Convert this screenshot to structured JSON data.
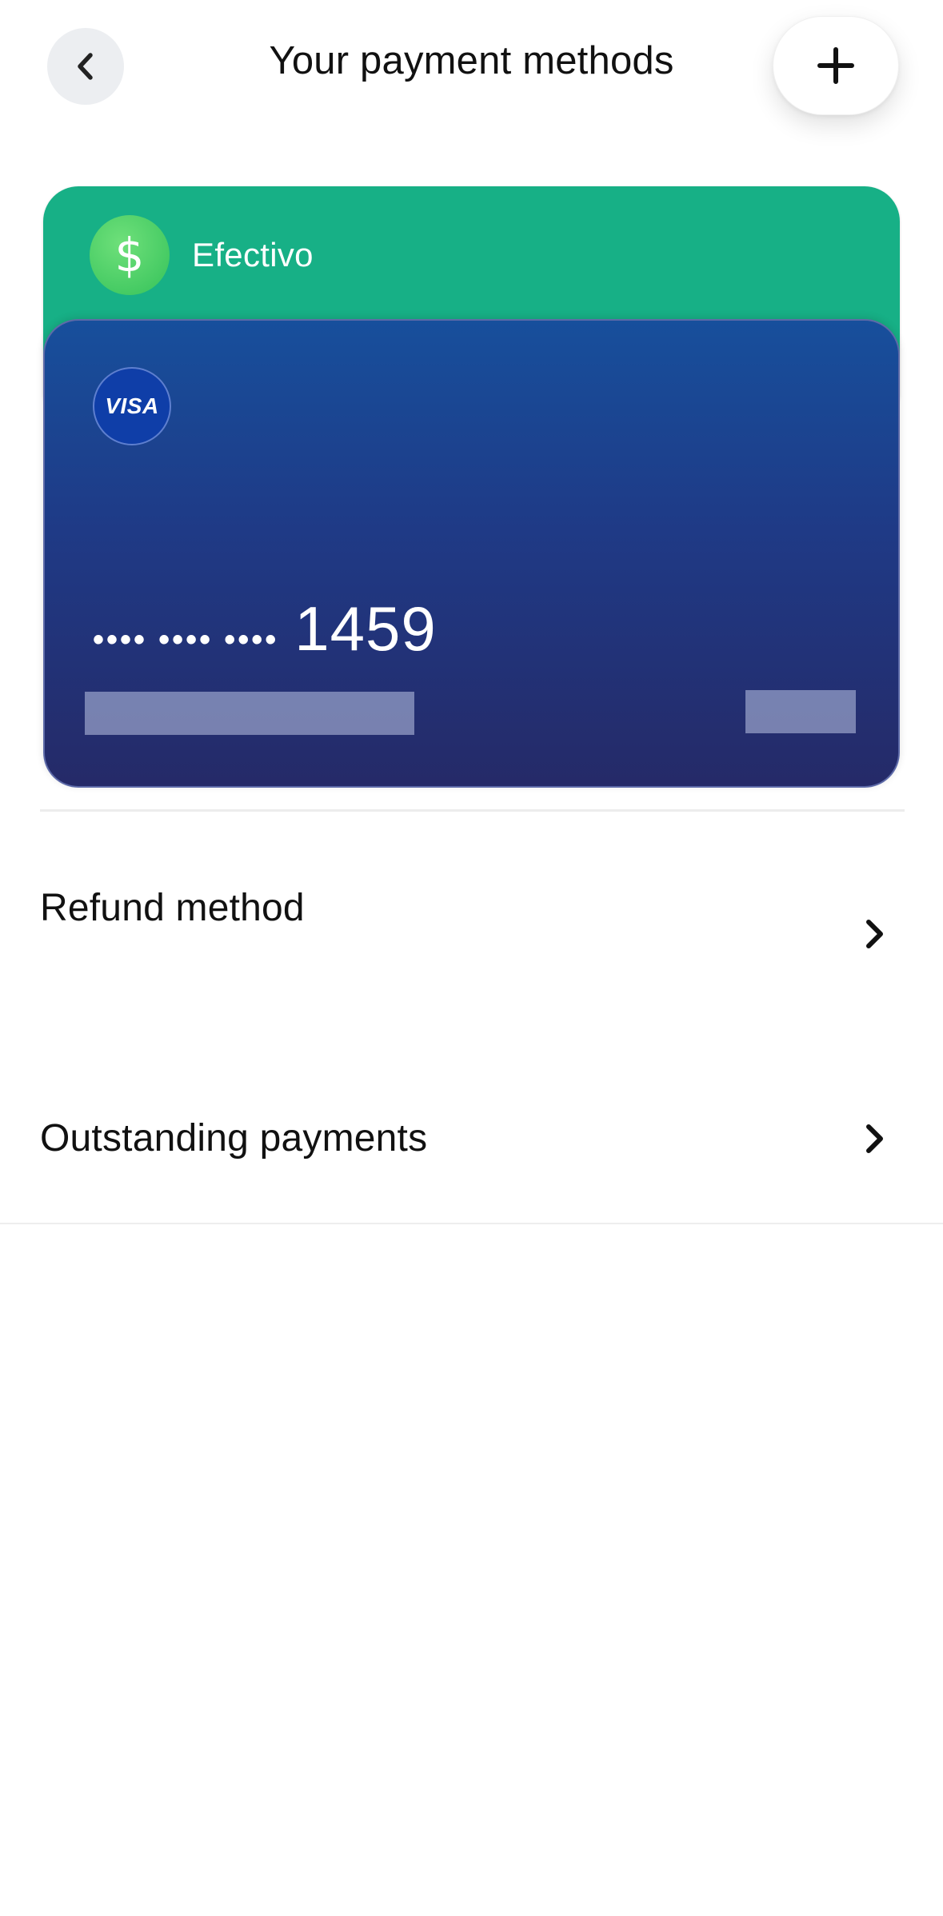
{
  "header": {
    "title": "Your payment methods",
    "back_icon": "chevron-left-icon",
    "add_icon": "plus-icon"
  },
  "cards": {
    "cash": {
      "label": "Efectivo",
      "icon": "dollar-icon",
      "icon_glyph": "$",
      "color": "#17b086"
    },
    "visa": {
      "brand": "VISA",
      "masked_groups": "•••• •••• ••••",
      "last4": "1459",
      "color_top": "#174f9c",
      "color_bottom": "#252a68"
    }
  },
  "list": {
    "items": [
      {
        "label": "Refund method",
        "icon": "chevron-right-icon"
      },
      {
        "label": "Outstanding payments",
        "icon": "chevron-right-icon"
      }
    ]
  }
}
